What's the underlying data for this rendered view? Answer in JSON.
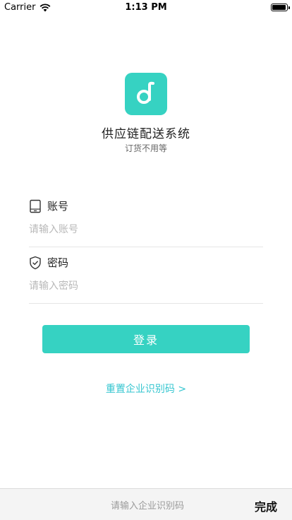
{
  "status_bar": {
    "carrier": "Carrier",
    "time": "1:13 PM",
    "battery_level": 1.0
  },
  "app": {
    "logo_icon": "d-logo-icon",
    "title": "供应链配送系统",
    "subtitle": "订货不用等",
    "accent_color": "#36d2c2"
  },
  "account": {
    "label": "账号",
    "icon": "tablet-icon",
    "placeholder": "请输入账号",
    "value": ""
  },
  "password": {
    "label": "密码",
    "icon": "shield-check-icon",
    "placeholder": "请输入密码",
    "value": ""
  },
  "login_button": "登录",
  "reset_link": "重置企业识别码 >",
  "bottom_bar": {
    "placeholder": "请输入企业识别码",
    "value": "",
    "done": "完成"
  }
}
